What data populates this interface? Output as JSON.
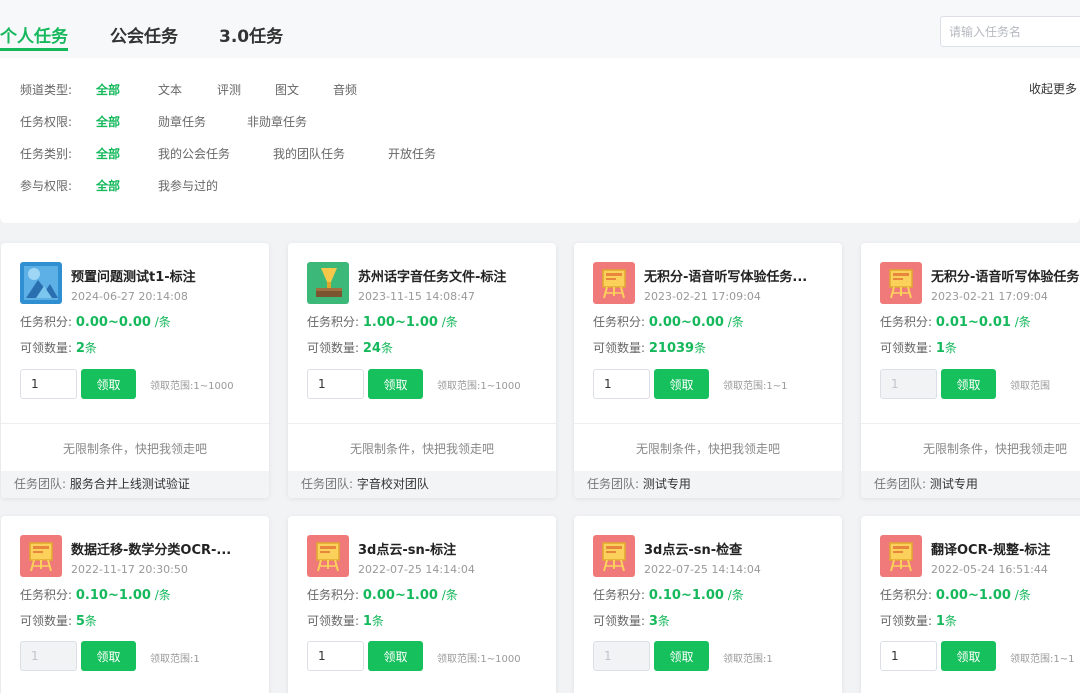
{
  "tabs": [
    {
      "label": "个人任务",
      "active": true
    },
    {
      "label": "公会任务",
      "active": false
    },
    {
      "label": "3.0任务",
      "active": false
    }
  ],
  "search": {
    "placeholder": "请输入任务名"
  },
  "filters": {
    "collapse_label": "收起更多",
    "rows": [
      {
        "label": "频道类型:",
        "options": [
          "全部",
          "文本",
          "评测",
          "图文",
          "音频"
        ]
      },
      {
        "label": "任务权限:",
        "options": [
          "全部",
          "勋章任务",
          "非勋章任务"
        ]
      },
      {
        "label": "任务类别:",
        "options": [
          "全部",
          "我的公会任务",
          "我的团队任务",
          "开放任务"
        ]
      },
      {
        "label": "参与权限:",
        "options": [
          "全部",
          "我参与过的"
        ]
      }
    ]
  },
  "card_labels": {
    "points": "任务积分:",
    "quantity": "可领数量:",
    "claim": "领取",
    "range_prefix": "领取范围:",
    "team": "任务团队:",
    "unit_per": "/条",
    "unit_count": "条"
  },
  "cards": [
    {
      "title": "预置问题测试t1-标注",
      "date": "2024-06-27 20:14:08",
      "points": "0.00~0.00",
      "quantity": "2",
      "input": "1",
      "input_disabled": false,
      "range": "领取范围:1~1000",
      "message": "无限制条件，快把我领走吧",
      "team": "服务合并上线测试验证",
      "icon": "blue-image-icon"
    },
    {
      "title": "苏州话字音任务文件-标注",
      "date": "2023-11-15 14:08:47",
      "points": "1.00~1.00",
      "quantity": "24",
      "input": "1",
      "input_disabled": false,
      "range": "领取范围:1~1000",
      "message": "无限制条件，快把我领走吧",
      "team": "字音校对团队",
      "icon": "green-gramophone-icon"
    },
    {
      "title": "无积分-语音听写体验任务...",
      "date": "2023-02-21 17:09:04",
      "points": "0.00~0.00",
      "quantity": "21039",
      "input": "1",
      "input_disabled": false,
      "range": "领取范围:1~1",
      "message": "无限制条件，快把我领走吧",
      "team": "测试专用",
      "icon": "red-easel-icon"
    },
    {
      "title": "无积分-语音听写体验任务",
      "date": "2023-02-21 17:09:04",
      "points": "0.01~0.01",
      "quantity": "1",
      "input": "1",
      "input_disabled": true,
      "range": "领取范围",
      "message": "无限制条件，快把我领走吧",
      "team": "测试专用",
      "icon": "red-easel-icon"
    },
    {
      "title": "数据迁移-数学分类OCR-...",
      "date": "2022-11-17 20:30:50",
      "points": "0.10~1.00",
      "quantity": "5",
      "input": "1",
      "input_disabled": true,
      "range": "领取范围:1",
      "icon": "red-easel-icon"
    },
    {
      "title": "3d点云-sn-标注",
      "date": "2022-07-25 14:14:04",
      "points": "0.00~1.00",
      "quantity": "1",
      "input": "1",
      "input_disabled": false,
      "range": "领取范围:1~1000",
      "icon": "red-easel-icon"
    },
    {
      "title": "3d点云-sn-检查",
      "date": "2022-07-25 14:14:04",
      "points": "0.10~1.00",
      "quantity": "3",
      "input": "1",
      "input_disabled": true,
      "range": "领取范围:1",
      "icon": "red-easel-icon"
    },
    {
      "title": "翻译OCR-规整-标注",
      "date": "2022-05-24 16:51:44",
      "points": "0.00~1.00",
      "quantity": "1",
      "input": "1",
      "input_disabled": false,
      "range": "领取范围:1~1",
      "icon": "red-easel-icon"
    }
  ],
  "colors": {
    "accent": "#16b85c",
    "button": "#16c05c",
    "easel_bg": "#f07a7a",
    "gramophone_bg": "#3cb878",
    "image_bg": "#2f8fd0"
  }
}
